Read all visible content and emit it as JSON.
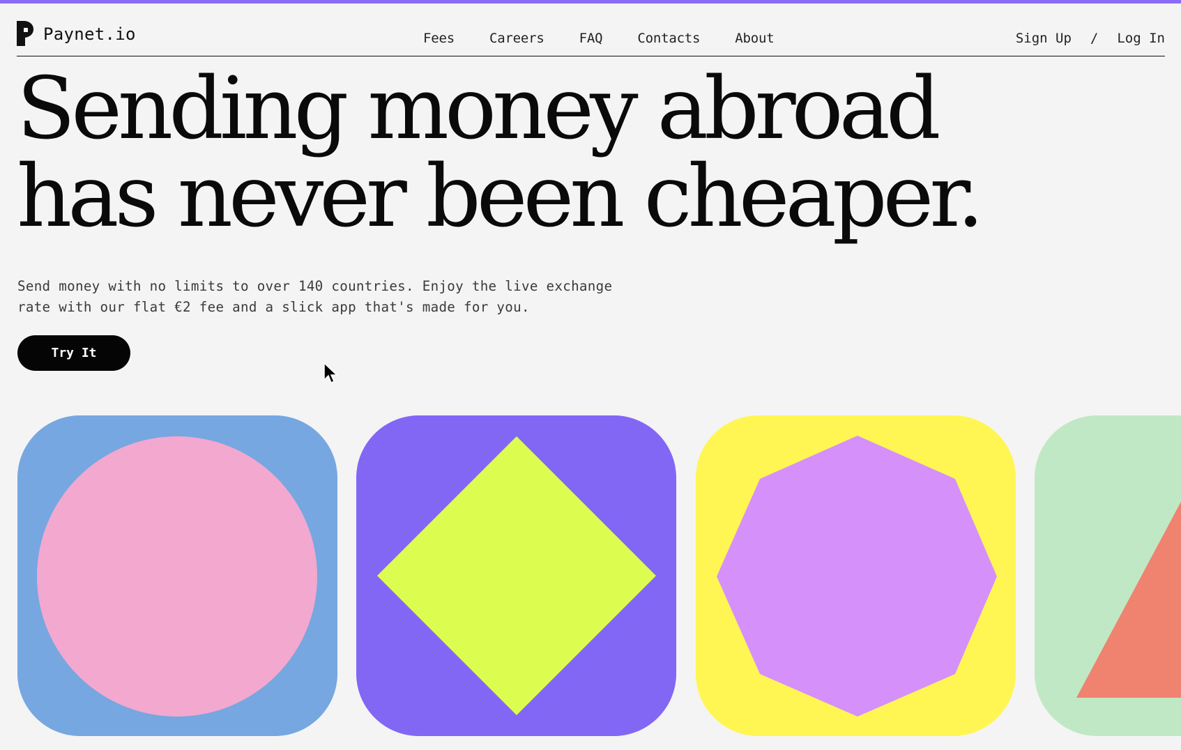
{
  "brand": {
    "name": "Paynet.io",
    "accent_color": "#8a6cf6",
    "logo_icon": "paynet-logo-icon"
  },
  "nav": {
    "links": [
      "Fees",
      "Careers",
      "FAQ",
      "Contacts",
      "About"
    ],
    "sign_up": "Sign Up",
    "separator": "/",
    "log_in": "Log In"
  },
  "hero": {
    "title_line1": "Sending money abroad",
    "title_line2": "has never been cheaper.",
    "description_line1": "Send money with no limits to over 140 countries. Enjoy the live exchange",
    "description_line2": "rate with our flat €2 fee and a slick app that's made for you.",
    "cta_label": "Try It"
  },
  "tiles": [
    {
      "shape": "circle",
      "background": "#76a7e0",
      "shape_color": "#f3a8cf"
    },
    {
      "shape": "diamond",
      "background": "#8267f5",
      "shape_color": "#dcfd50"
    },
    {
      "shape": "octagon",
      "background": "#fff654",
      "shape_color": "#d590fa"
    },
    {
      "shape": "triangle",
      "background": "#c0e8c4",
      "shape_color": "#f08270"
    }
  ],
  "cursor_icon": "mouse-pointer-icon"
}
